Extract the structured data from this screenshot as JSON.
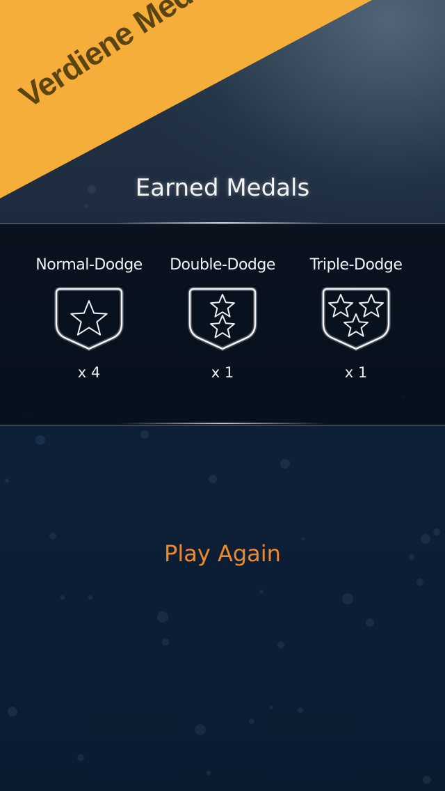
{
  "banner": {
    "text": "Verdiene Medaillen",
    "color": "#f6ae3a",
    "text_color": "#5b4412"
  },
  "header": {
    "title": "Earned Medals"
  },
  "medals": [
    {
      "name": "Normal-Dodge",
      "count": "x 4",
      "stars": 1,
      "icon": "shield-one-star-icon"
    },
    {
      "name": "Double-Dodge",
      "count": "x 1",
      "stars": 2,
      "icon": "shield-two-stars-icon"
    },
    {
      "name": "Triple-Dodge",
      "count": "x 1",
      "stars": 3,
      "icon": "shield-three-stars-icon"
    }
  ],
  "actions": {
    "play_again": "Play Again"
  },
  "colors": {
    "accent": "#f0892a",
    "panel": "#050c16",
    "background": "#0d2038"
  }
}
